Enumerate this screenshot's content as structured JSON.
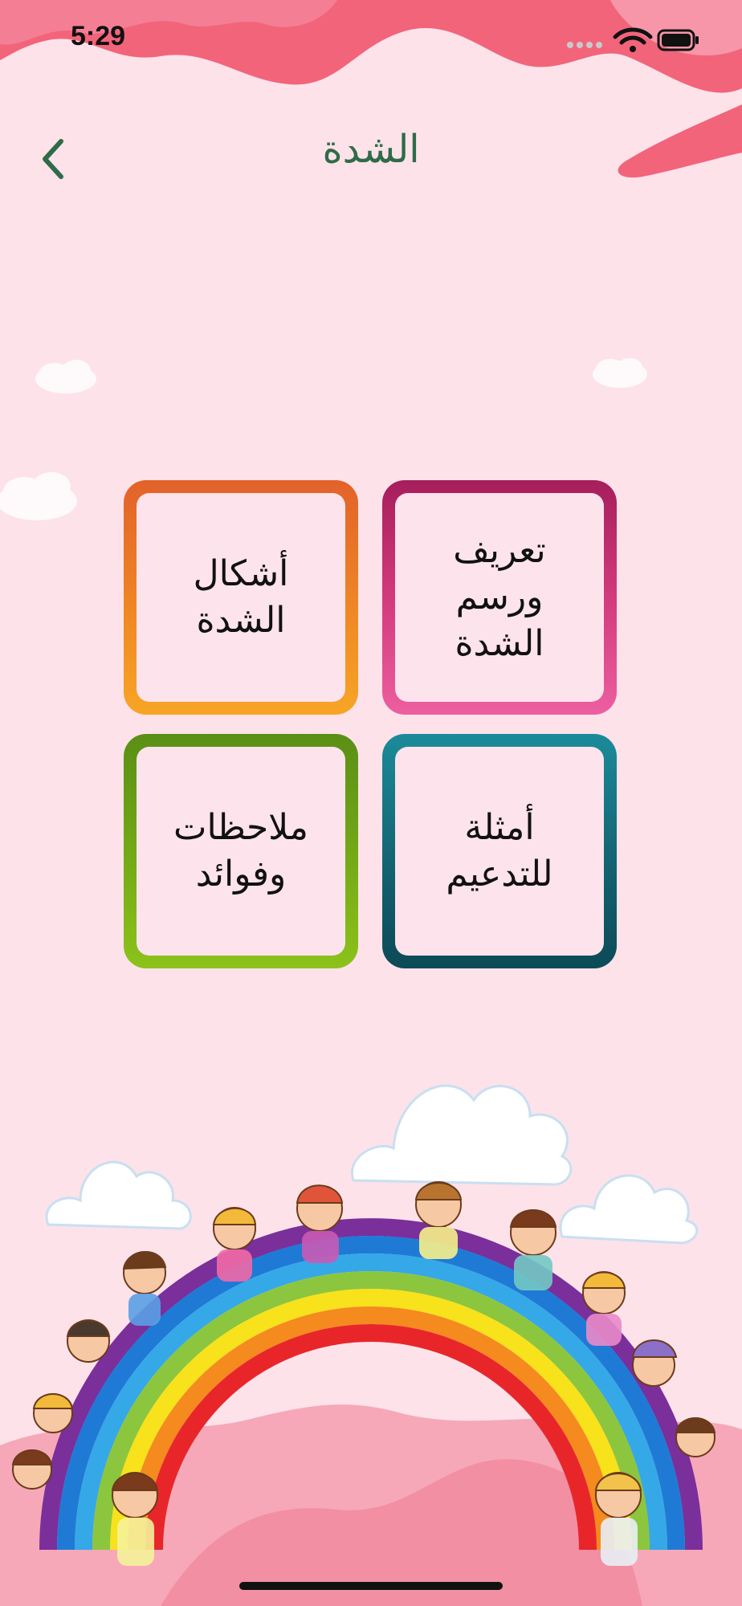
{
  "status_bar": {
    "time": "5:29",
    "icons": [
      "signal-dots-icon",
      "wifi-icon",
      "battery-icon"
    ]
  },
  "header": {
    "title": "الشدة",
    "back_icon": "chevron-left-icon"
  },
  "tiles": [
    {
      "label": "تعريف\nورسم\nالشدة",
      "color": "#d23a7c"
    },
    {
      "label": "أشكال\nالشدة",
      "color": "#f08a24"
    },
    {
      "label": "أمثلة\nللتدعيم",
      "color": "#13606e"
    },
    {
      "label": "ملاحظات\nوفوائد",
      "color": "#78ad17"
    }
  ],
  "colors": {
    "background": "#fde2ea",
    "title": "#2f6b48",
    "blob": "#f2647a"
  },
  "illustration": "rainbow-with-children"
}
